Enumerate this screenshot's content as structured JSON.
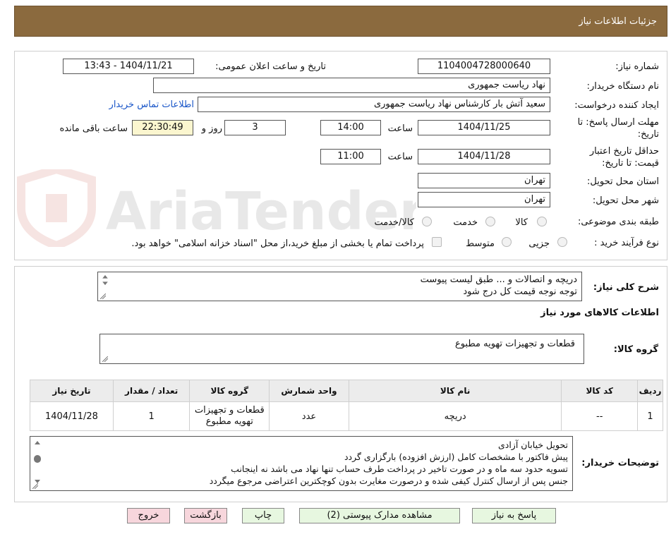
{
  "header": {
    "title": "جزئیات اطلاعات نیاز"
  },
  "form": {
    "need_number": {
      "label": "شماره نیاز:",
      "value": "1104004728000640"
    },
    "announce_datetime": {
      "label": "تاریخ و ساعت اعلان عمومی:",
      "value": "1404/11/21 - 13:43"
    },
    "buyer_org": {
      "label": "نام دستگاه خریدار:",
      "value": "نهاد ریاست جمهوری"
    },
    "requester": {
      "label": "ایجاد کننده درخواست:",
      "value": "سعید آتش بار کارشناس نهاد ریاست جمهوری"
    },
    "contact_link": "اطلاعات تماس خریدار",
    "reply_deadline": {
      "label": "مهلت ارسال پاسخ: تا تاریخ:",
      "date": "1404/11/25",
      "time_label": "ساعت",
      "time": "14:00",
      "days": "3",
      "days_label": "روز و",
      "remaining": "22:30:49",
      "remaining_label": "ساعت باقی مانده"
    },
    "price_validity": {
      "label": "حداقل تاریخ اعتبار قیمت: تا تاریخ:",
      "date": "1404/11/28",
      "time_label": "ساعت",
      "time": "11:00"
    },
    "province": {
      "label": "استان محل تحویل:",
      "value": "تهران"
    },
    "city": {
      "label": "شهر محل تحویل:",
      "value": "تهران"
    },
    "category": {
      "label": "طبقه بندی موضوعی:",
      "options": [
        "کالا",
        "خدمت",
        "کالا/خدمت"
      ]
    },
    "process": {
      "label": "نوع فرآیند خرید :",
      "options": [
        "جزیی",
        "متوسط"
      ],
      "note": "پرداخت تمام یا بخشی از مبلغ خرید،از محل \"اسناد خزانه اسلامی\" خواهد بود."
    }
  },
  "description": {
    "label": "شرح کلی نیاز:",
    "lines": [
      "دریچه و اتصالات و ... طبق لیست پیوست",
      "توجه نوجه قیمت کل درج شود"
    ]
  },
  "goods_section": {
    "title": "اطلاعات کالاهای مورد نیاز",
    "group_label": "گروه کالا:",
    "group_value": "قطعات و تجهیزات تهویه مطبوع"
  },
  "table": {
    "headers": [
      "ردیف",
      "کد کالا",
      "نام کالا",
      "واحد شمارش",
      "گروه کالا",
      "تعداد / مقدار",
      "تاریخ نیاز"
    ],
    "rows": [
      [
        "1",
        "--",
        "دریچه",
        "عدد",
        "قطعات و تجهیزات تهویه مطبوع",
        "1",
        "1404/11/28"
      ]
    ]
  },
  "buyer_notes": {
    "label": "توضیحات خریدار:",
    "lines": [
      "تحویل خیابان آزادی",
      "پیش فاکتور با مشخصات کامل (ارزش افزوده) بارگزاری گردد",
      "تسویه حدود سه ماه و در صورت تاخیر در پرداخت طرف حساب تنها نهاد می باشد نه اینجانب",
      "جنس پس از ارسال کنترل کیفی شده و درصورت مغایرت بدون کوچکترین اعتراضی مرجوع میگردد"
    ]
  },
  "buttons": {
    "reply": "پاسخ به نیاز",
    "attachments": "مشاهده مدارک پیوستی (2)",
    "print": "چاپ",
    "back": "بازگشت",
    "exit": "خروج"
  },
  "watermark": {
    "text": "AriaTender.neT"
  },
  "colors": {
    "header": "#8b6a3e",
    "link": "#1a56c8",
    "green_button": "#e7f7e0",
    "pink_button": "#f7d6dc",
    "timer_bg": "#fbf6cf"
  }
}
